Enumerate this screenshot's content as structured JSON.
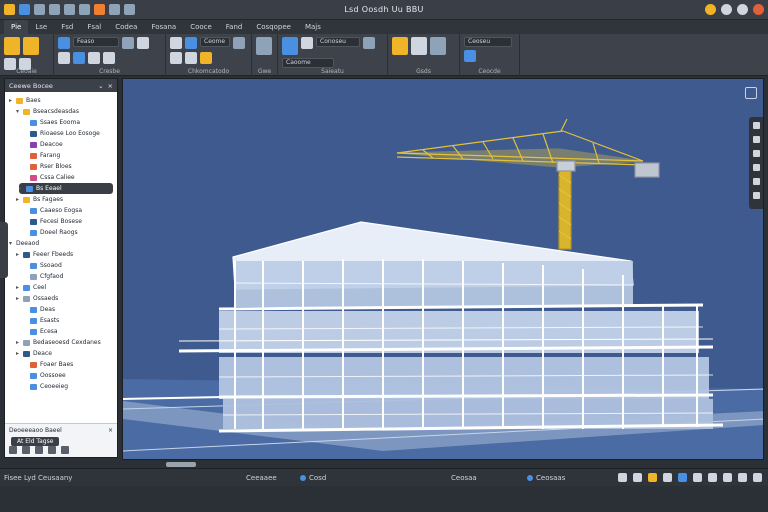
{
  "app": {
    "title": "Lsd Oosdh Uu BBU",
    "quick_access_colors": [
      "#f0b429",
      "#4a90e2",
      "#8fa3b8",
      "#8fa3b8",
      "#8fa3b8",
      "#8fa3b8",
      "#f08030",
      "#8fa3b8",
      "#8fa3b8"
    ]
  },
  "menu": {
    "tabs": [
      "Pie",
      "Lse",
      "Fsd",
      "Fsal",
      "Codea",
      "Fosana",
      "Cooce",
      "Fand",
      "Cosqopee",
      "Majs"
    ]
  },
  "ribbon": {
    "groups": [
      {
        "label": "Ceoaie"
      },
      {
        "label": "Cresbe"
      },
      {
        "label": "Chkomcatodo"
      },
      {
        "label": "Gwe"
      },
      {
        "label": "Saieatu"
      },
      {
        "label": "Gsds"
      },
      {
        "label": "Ceocde"
      }
    ],
    "field_1": "Feaso",
    "field_2": "Ceome",
    "field_3": "Conoseu",
    "field_4": "Caoome",
    "field_5": "Ceoseu"
  },
  "panel": {
    "title": "Ceewe Bocee",
    "tree": [
      {
        "label": "Baes",
        "level": 0,
        "arrow": "▸",
        "color": "#f0b429"
      },
      {
        "label": "Bseacsdeasdas",
        "level": 1,
        "arrow": "▾",
        "color": "#f0b429"
      },
      {
        "label": "Ssaes Eooma",
        "level": 2,
        "arrow": "",
        "color": "#4a90e2"
      },
      {
        "label": "Rioaese Loo Eosoge",
        "level": 2,
        "arrow": "",
        "color": "#2e5a8a"
      },
      {
        "label": "Deacoe",
        "level": 2,
        "arrow": "",
        "color": "#8a3fb0"
      },
      {
        "label": "Farang",
        "level": 2,
        "arrow": "",
        "color": "#e0603a"
      },
      {
        "label": "Rser Bloes",
        "level": 2,
        "arrow": "",
        "color": "#e0603a"
      },
      {
        "label": "Cssa Caliee",
        "level": 2,
        "arrow": "",
        "color": "#d44a8a"
      },
      {
        "label": "Bs Eeael",
        "level": 1,
        "arrow": "▸",
        "color": "#4a90e2",
        "selected": true
      },
      {
        "label": "Bs Fagaes",
        "level": 1,
        "arrow": "▸",
        "color": "#f0b429"
      },
      {
        "label": "Caaeso Eogsa",
        "level": 2,
        "arrow": "",
        "color": "#4a90e2"
      },
      {
        "label": "Fecesi Bosese",
        "level": 2,
        "arrow": "",
        "color": "#2e5a8a"
      },
      {
        "label": "Doeel Raogs",
        "level": 2,
        "arrow": "",
        "color": "#4a90e2"
      },
      {
        "label": "Deeaod",
        "level": 0,
        "arrow": "▾",
        "color": ""
      },
      {
        "label": "Feeer Fbeeds",
        "level": 1,
        "arrow": "▸",
        "color": "#2e5a8a"
      },
      {
        "label": "Ssoaod",
        "level": 2,
        "arrow": "",
        "color": "#4a90e2"
      },
      {
        "label": "Cfgfaod",
        "level": 2,
        "arrow": "",
        "color": "#8fa3b8"
      },
      {
        "label": "Ceel",
        "level": 1,
        "arrow": "▸",
        "color": "#4a90e2"
      },
      {
        "label": "Ossaeds",
        "level": 1,
        "arrow": "▸",
        "color": "#8fa3b8"
      },
      {
        "label": "Deas",
        "level": 2,
        "arrow": "",
        "color": "#4a90e2"
      },
      {
        "label": "Esasts",
        "level": 2,
        "arrow": "",
        "color": "#4a90e2"
      },
      {
        "label": "Ecesa",
        "level": 2,
        "arrow": "",
        "color": "#4a90e2"
      },
      {
        "label": "Bedaseoesd Cexdanes",
        "level": 1,
        "arrow": "▸",
        "color": "#8fa3b8"
      },
      {
        "label": "Deace",
        "level": 1,
        "arrow": "▸",
        "color": "#2e5a8a"
      },
      {
        "label": "Foaer Baes",
        "level": 2,
        "arrow": "",
        "color": "#e0603a"
      },
      {
        "label": "Oossoee",
        "level": 2,
        "arrow": "",
        "color": "#4a90e2"
      },
      {
        "label": "Ceoeeieg",
        "level": 2,
        "arrow": "",
        "color": "#4a90e2"
      }
    ],
    "footer_title": "Deoeeeaoo Baeel",
    "footer_tab": "At Eld Tagse"
  },
  "statusbar": {
    "left": "Fisee Lyd Ceusaany",
    "mid1": "Ceeaaee",
    "mid2": "Cosd",
    "mid3": "Ceosaa",
    "mid4": "Ceosaas",
    "icon_colors": [
      "#cfd6e0",
      "#cfd6e0",
      "#f0b429",
      "#cfd6e0",
      "#4a90e2",
      "#cfd6e0",
      "#cfd6e0",
      "#cfd6e0",
      "#cfd6e0",
      "#cfd6e0"
    ]
  },
  "colors": {
    "viewport_bg": "#3e5a8e",
    "crane": "#e3c23a",
    "building_face": "#dde6f3",
    "building_glass": "#b9cbe4"
  }
}
